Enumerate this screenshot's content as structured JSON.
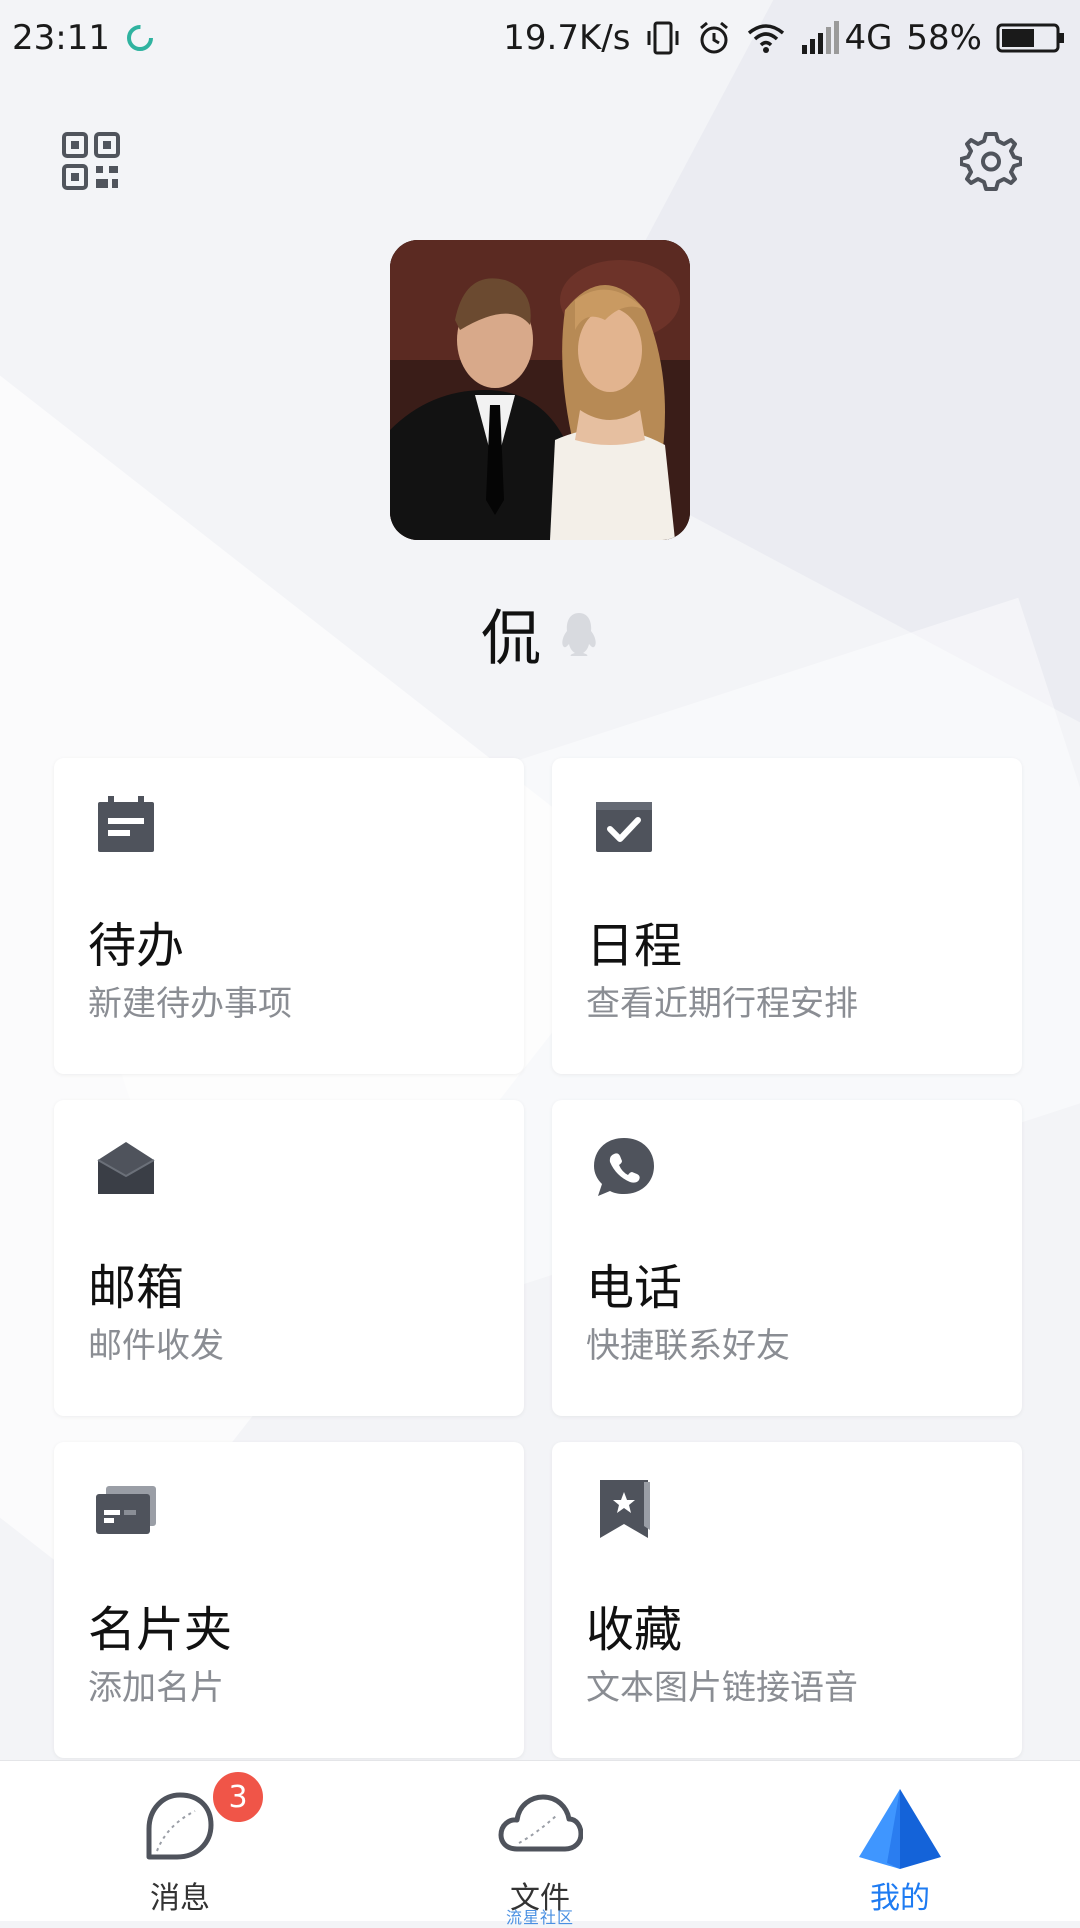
{
  "status_bar": {
    "time": "23:11",
    "speed": "19.7K/s",
    "network": "4G",
    "battery": "58%"
  },
  "profile": {
    "name": "侃"
  },
  "cards": [
    {
      "title": "待办",
      "subtitle": "新建待办事项",
      "icon": "todo-calendar-icon"
    },
    {
      "title": "日程",
      "subtitle": "查看近期行程安排",
      "icon": "schedule-check-icon"
    },
    {
      "title": "邮箱",
      "subtitle": "邮件收发",
      "icon": "mail-envelope-icon"
    },
    {
      "title": "电话",
      "subtitle": "快捷联系好友",
      "icon": "phone-bubble-icon"
    },
    {
      "title": "名片夹",
      "subtitle": "添加名片",
      "icon": "business-card-icon"
    },
    {
      "title": "收藏",
      "subtitle": "文本图片链接语音",
      "icon": "bookmark-star-icon"
    }
  ],
  "bottom_nav": {
    "items": [
      {
        "label": "消息",
        "icon": "message-bubble-icon",
        "badge": "3"
      },
      {
        "label": "文件",
        "icon": "cloud-icon",
        "watermark": "流星社区"
      },
      {
        "label": "我的",
        "icon": "tim-logo-icon",
        "active": true
      }
    ]
  },
  "colors": {
    "accent": "#1e7bf2",
    "badge": "#f05548",
    "icon_gray": "#4f535c",
    "subtitle_gray": "#8a8d93"
  }
}
